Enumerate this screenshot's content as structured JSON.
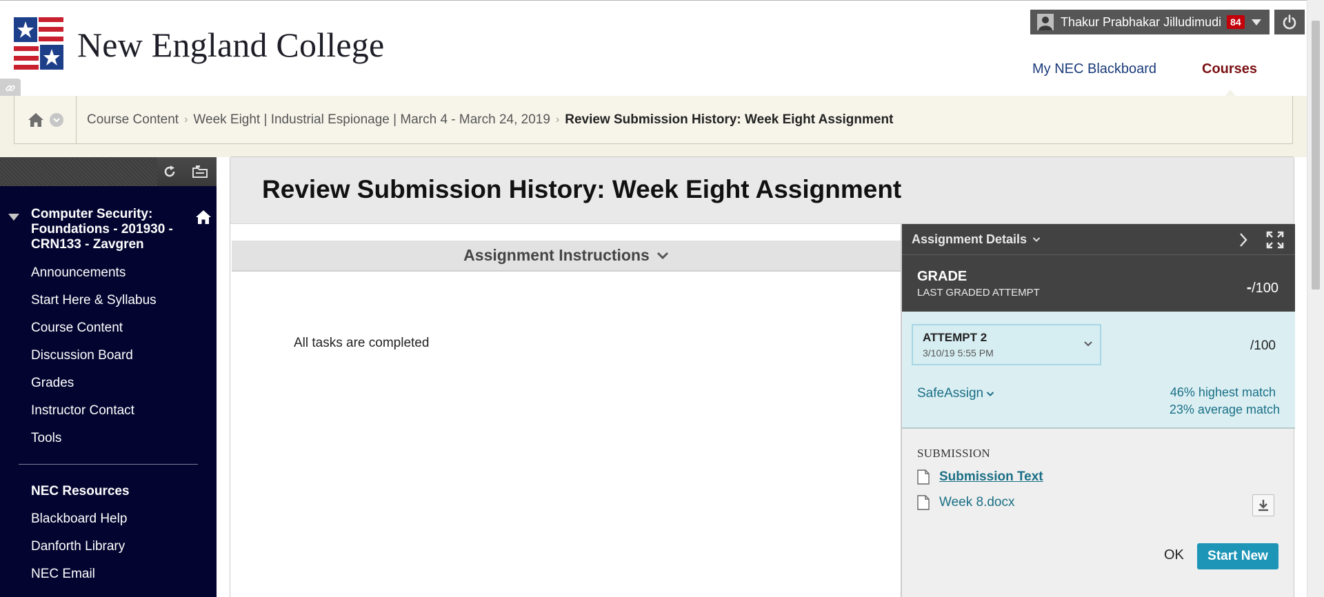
{
  "header": {
    "logo_text": "New England College",
    "user_name": "Thakur Prabhakar Jilludimudi",
    "notification_count": "84",
    "nav": {
      "my_blackboard": "My NEC Blackboard",
      "courses": "Courses"
    }
  },
  "breadcrumb": {
    "items": [
      "Course Content",
      "Week Eight | Industrial Espionage | March 4 - March 24, 2019"
    ],
    "current": "Review Submission History: Week Eight Assignment"
  },
  "sidebar": {
    "course_title": "Computer Security: Foundations - 201930 - CRN133 - Zavgren",
    "items": [
      "Announcements",
      "Start Here & Syllabus",
      "Course Content",
      "Discussion Board",
      "Grades",
      "Instructor Contact",
      "Tools"
    ],
    "section_title": "NEC Resources",
    "section_items": [
      "Blackboard Help",
      "Danforth Library",
      "NEC Email"
    ]
  },
  "main": {
    "page_title": "Review Submission History: Week Eight Assignment",
    "instructions_label": "Assignment Instructions",
    "instructions_body": "All tasks are completed"
  },
  "panel": {
    "title": "Assignment Details",
    "grade_label": "GRADE",
    "grade_sub": "LAST GRADED ATTEMPT",
    "grade_value": "-",
    "grade_total": "/100",
    "attempt_name": "ATTEMPT 2",
    "attempt_date": "3/10/19 5:55 PM",
    "attempt_score": "/100",
    "safeassign_label": "SafeAssign",
    "highest_pct": "46% h",
    "highest_rest": "ighest match",
    "average_match": "23% average match",
    "submission_label": "SUBMISSION",
    "files": [
      "Submission Text",
      "Week 8.docx"
    ],
    "ok_label": "OK",
    "start_new_label": "Start New"
  },
  "colors": {
    "sidebar_bg": "#030530",
    "link": "#1a6f85",
    "accent_button": "#1d95b7",
    "courses_tab": "#7a0f12",
    "highlight": "#f0f52b"
  }
}
